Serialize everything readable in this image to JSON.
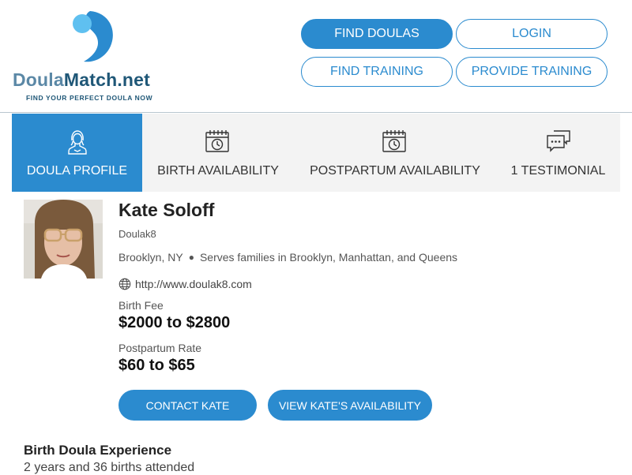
{
  "header": {
    "logo": {
      "name_part1": "Doula",
      "name_part2": "Match.net",
      "tagline": "FIND YOUR PERFECT DOULA NOW"
    },
    "nav": {
      "find_doulas": "FIND DOULAS",
      "login": "LOGIN",
      "find_training": "FIND TRAINING",
      "provide_training": "PROVIDE TRAINING"
    }
  },
  "tabs": [
    {
      "label": "DOULA PROFILE",
      "icon": "person-icon",
      "active": true
    },
    {
      "label": "BIRTH AVAILABILITY",
      "icon": "calendar-clock-icon"
    },
    {
      "label": "POSTPARTUM AVAILABILITY",
      "icon": "calendar-clock-icon"
    },
    {
      "label": "1 TESTIMONIAL",
      "icon": "chat-bubbles-icon"
    }
  ],
  "profile": {
    "name": "Kate Soloff",
    "business": "Doulak8",
    "city": "Brooklyn, NY",
    "service_area": "Serves families in Brooklyn, Manhattan, and Queens",
    "website": "http://www.doulak8.com",
    "birth_fee_label": "Birth Fee",
    "birth_fee": "$2000 to $2800",
    "postpartum_rate_label": "Postpartum Rate",
    "postpartum_rate": "$60 to $65",
    "contact_button": "CONTACT KATE",
    "availability_button": "VIEW KATE'S AVAILABILITY"
  },
  "experience": {
    "title": "Birth Doula Experience",
    "text": "2 years and 36 births attended"
  },
  "colors": {
    "accent": "#2b8bcf",
    "logo_light": "#5fc0f0",
    "logo_dark": "#1f5777"
  }
}
